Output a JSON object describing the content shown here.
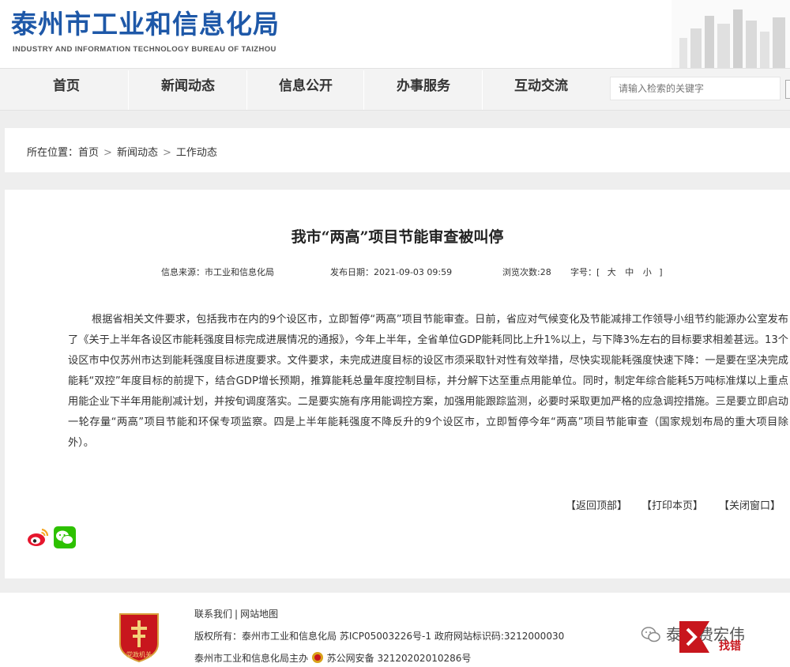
{
  "header": {
    "title": "泰州市工业和信息化局",
    "subtitle": "INDUSTRY AND INFORMATION TECHNOLOGY BUREAU OF TAIZHOU"
  },
  "nav": {
    "items": [
      {
        "label": "首页"
      },
      {
        "label": "新闻动态"
      },
      {
        "label": "信息公开"
      },
      {
        "label": "办事服务"
      },
      {
        "label": "互动交流"
      }
    ],
    "search_placeholder": "请输入检索的关键字"
  },
  "breadcrumb": {
    "prefix": "所在位置：",
    "items": [
      "首页",
      "新闻动态",
      "工作动态"
    ],
    "separator": ">"
  },
  "article": {
    "title": "我市“两高”项目节能审查被叫停",
    "source_label": "信息来源：",
    "source": "市工业和信息化局",
    "date_label": "发布日期：",
    "date": "2021-09-03 09:59",
    "views_label": "浏览次数:",
    "views": "28",
    "fontsize_label": "字号：",
    "fontsize_open": "[",
    "fontsize_large": "大",
    "fontsize_medium": "中",
    "fontsize_small": "小",
    "fontsize_close": "]",
    "body": "根据省相关文件要求，包括我市在内的9个设区市，立即暂停“两高”项目节能审查。日前，省应对气候变化及节能减排工作领导小组节约能源办公室发布了《关于上半年各设区市能耗强度目标完成进展情况的通报》，今年上半年，全省单位GDP能耗同比上升1%以上，与下降3%左右的目标要求相差甚远。13个设区市中仅苏州市达到能耗强度目标进度要求。文件要求，未完成进度目标的设区市须采取针对性有效举措，尽快实现能耗强度快速下降：一是要在坚决完成能耗“双控”年度目标的前提下，结合GDP增长预期，推算能耗总量年度控制目标，并分解下达至重点用能单位。同时，制定年综合能耗5万吨标准煤以上重点用能企业下半年用能削减计划，并按旬调度落实。二是要实施有序用能调控方案，加强用能跟踪监测，必要时采取更加严格的应急调控措施。三是要立即启动一轮存量“两高”项目节能和环保专项监察。四是上半年能耗强度不降反升的9个设区市，立即暂停今年“两高”项目节能审查（国家规划布局的重大项目除外）。"
  },
  "tools": {
    "back_top": "【返回顶部】",
    "print": "【打印本页】",
    "close": "【关闭窗口】"
  },
  "footer": {
    "contact": "联系我们",
    "divider": "|",
    "sitemap": "网站地图",
    "copyright": "版权所有：泰州市工业和信息化局 苏ICP05003226号-1 政府网站标识码:3212000030",
    "host": "泰州市工业和信息化局主办",
    "police": "苏公网安备 32120202010286号",
    "emblem_text": "党政机关",
    "wechat_name": "泰州费宏伟",
    "error_label": "找错"
  },
  "colors": {
    "title_blue": "#1e58a8",
    "emblem_red": "#c8161d",
    "weibo_red": "#e6162d",
    "wechat_green": "#2dc100"
  }
}
